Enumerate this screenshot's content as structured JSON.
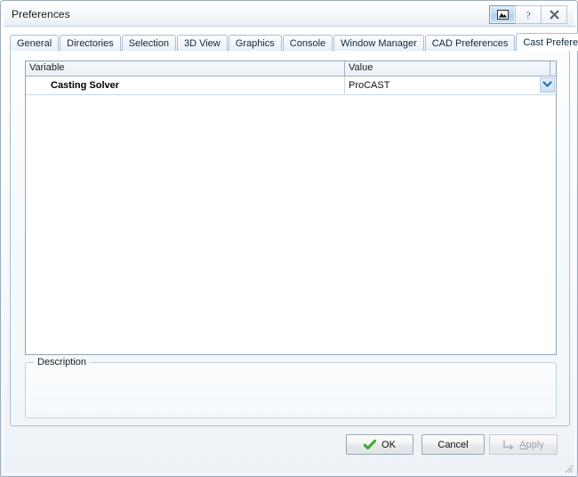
{
  "window": {
    "title": "Preferences",
    "controls": [
      {
        "name": "restore-button",
        "icon": "restore-icon",
        "state": "active"
      },
      {
        "name": "help-button",
        "icon": "question-mark-icon",
        "label": "?"
      },
      {
        "name": "close-button",
        "icon": "close-x-icon",
        "label": "X"
      }
    ]
  },
  "tabs": [
    {
      "label": "General",
      "active": false
    },
    {
      "label": "Directories",
      "active": false
    },
    {
      "label": "Selection",
      "active": false
    },
    {
      "label": "3D View",
      "active": false
    },
    {
      "label": "Graphics",
      "active": false
    },
    {
      "label": "Console",
      "active": false
    },
    {
      "label": "Window Manager",
      "active": false
    },
    {
      "label": "CAD Preferences",
      "active": false
    },
    {
      "label": "Cast Preferences",
      "active": true
    }
  ],
  "table": {
    "columns": [
      "Variable",
      "Value"
    ],
    "rows": [
      {
        "variable": "Casting Solver",
        "value": "ProCAST",
        "editor": "dropdown",
        "dropdown_icon": "chevron-down-icon"
      }
    ]
  },
  "description": {
    "legend": "Description",
    "text": ""
  },
  "buttons": {
    "ok": {
      "label": "OK",
      "icon": "green-check-icon",
      "enabled": true
    },
    "cancel": {
      "label": "Cancel",
      "enabled": true
    },
    "apply": {
      "label": "Apply",
      "accelerator": "A",
      "icon": "apply-arrow-icon",
      "enabled": false
    }
  },
  "colors": {
    "accent_blue": "#5b9ddb",
    "tab_border": "#a8bed4",
    "header_bg": "#eaf0f7",
    "check_green": "#3faa35",
    "dropdown_arrow": "#2f6fad",
    "disabled_text": "#9ba2a9"
  }
}
